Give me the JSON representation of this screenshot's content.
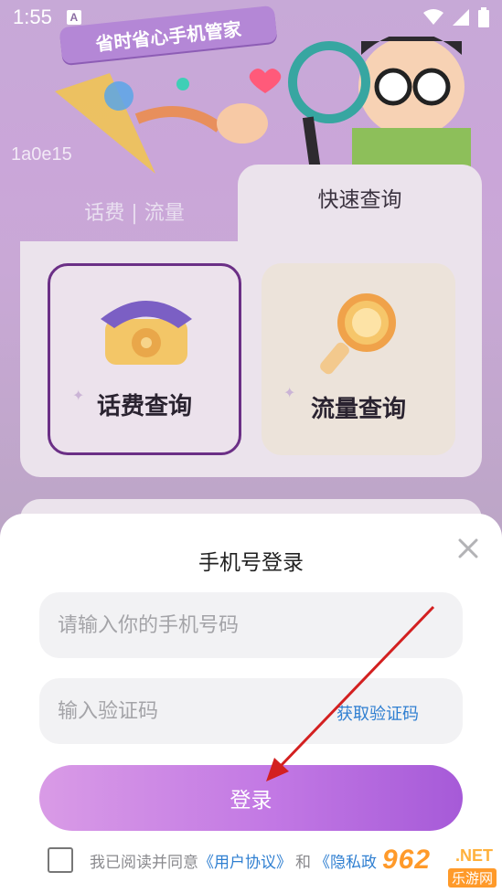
{
  "status_bar": {
    "time": "1:55",
    "notification_icon": "A"
  },
  "background": {
    "banner_text": "省时省心手机管家",
    "overlay_code": "1a0e15",
    "tabs": [
      {
        "label": "话费 | 流量"
      },
      {
        "label": "快速查询"
      }
    ],
    "cards": [
      {
        "label": "话费查询",
        "icon": "telephone-icon"
      },
      {
        "label": "流量查询",
        "icon": "magnifier-icon"
      }
    ]
  },
  "modal": {
    "title": "手机号登录",
    "phone_placeholder": "请输入你的手机号码",
    "code_placeholder": "输入验证码",
    "get_code_label": "获取验证码",
    "login_label": "登录",
    "agreement": {
      "prefix": "我已阅读并同意",
      "user_agreement": "《用户协议》",
      "and": "和",
      "privacy_policy": "《隐私政"
    }
  },
  "watermark": {
    "big": "962",
    "net": ".NET",
    "sub": "乐游网"
  },
  "colors": {
    "accent": "#b06ae0",
    "link": "#2f7fd1",
    "selected_card_border": "#6b2f86",
    "arrow": "#d32020"
  }
}
